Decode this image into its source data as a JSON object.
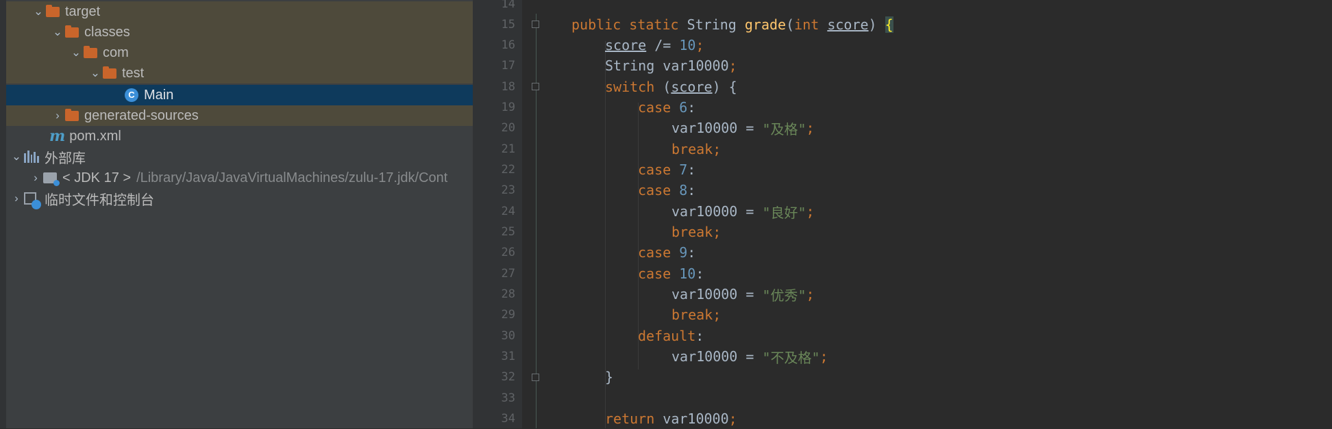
{
  "sidebar": {
    "rows": [
      {
        "label": "target",
        "icon": "folder-icon",
        "chevron": "expanded"
      },
      {
        "label": "classes",
        "icon": "folder-icon",
        "chevron": "expanded"
      },
      {
        "label": "com",
        "icon": "folder-icon",
        "chevron": "expanded"
      },
      {
        "label": "test",
        "icon": "folder-icon",
        "chevron": "expanded"
      },
      {
        "label": "Main",
        "icon": "class-icon",
        "chevron": "none",
        "selected": true
      },
      {
        "label": "generated-sources",
        "icon": "folder-icon",
        "chevron": "collapsed"
      },
      {
        "label": "pom.xml",
        "icon": "maven-icon",
        "chevron": "none"
      },
      {
        "label": "外部库",
        "icon": "library-icon",
        "chevron": "expanded"
      },
      {
        "label": "< JDK 17 >",
        "path": "/Library/Java/JavaVirtualMachines/zulu-17.jdk/Cont",
        "icon": "jdk-icon",
        "chevron": "collapsed"
      },
      {
        "label": "临时文件和控制台",
        "icon": "scratch-icon",
        "chevron": "collapsed"
      }
    ]
  },
  "editor": {
    "line_numbers": [
      "14",
      "15",
      "16",
      "17",
      "18",
      "19",
      "20",
      "21",
      "22",
      "23",
      "24",
      "25",
      "26",
      "27",
      "28",
      "29",
      "30",
      "31",
      "32",
      "33",
      "34"
    ],
    "code": {
      "l15": {
        "public": "public",
        "static": "static",
        "type": "String",
        "name": "grade",
        "open": "(",
        "int": "int",
        "param": "score",
        "close": ") ",
        "brace": "{"
      },
      "l16": {
        "param": "score",
        "rest": " /= ",
        "num": "10",
        "semi": ";"
      },
      "l17": {
        "text": "String var10000",
        "semi": ";"
      },
      "l18": {
        "kw": "switch",
        "open": " (",
        "param": "score",
        "rest": ") {"
      },
      "l19": {
        "kw": "case ",
        "num": "6",
        "rest": ":"
      },
      "l20": {
        "var": "var10000 = ",
        "str": "\"及格\"",
        "semi": ";"
      },
      "l21": {
        "kw": "break;"
      },
      "l22": {
        "kw": "case ",
        "num": "7",
        "rest": ":"
      },
      "l23": {
        "kw": "case ",
        "num": "8",
        "rest": ":"
      },
      "l24": {
        "var": "var10000 = ",
        "str": "\"良好\"",
        "semi": ";"
      },
      "l25": {
        "kw": "break;"
      },
      "l26": {
        "kw": "case ",
        "num": "9",
        "rest": ":"
      },
      "l27": {
        "kw": "case ",
        "num": "10",
        "rest": ":"
      },
      "l28": {
        "var": "var10000 = ",
        "str": "\"优秀\"",
        "semi": ";"
      },
      "l29": {
        "kw": "break;"
      },
      "l30": {
        "kw": "default",
        "rest": ":"
      },
      "l31": {
        "var": "var10000 = ",
        "str": "\"不及格\"",
        "semi": ";"
      },
      "l32": {
        "text": "}"
      },
      "l34": {
        "kw": "return ",
        "var": "var10000",
        "semi": ";"
      }
    }
  },
  "colors": {
    "keyword": "#cc7832",
    "function": "#ffc66d",
    "number": "#6897bb",
    "string": "#6a8759",
    "text": "#a9b7c6",
    "selected": "#0e3a5c",
    "excluded": "#4e4a3b"
  }
}
